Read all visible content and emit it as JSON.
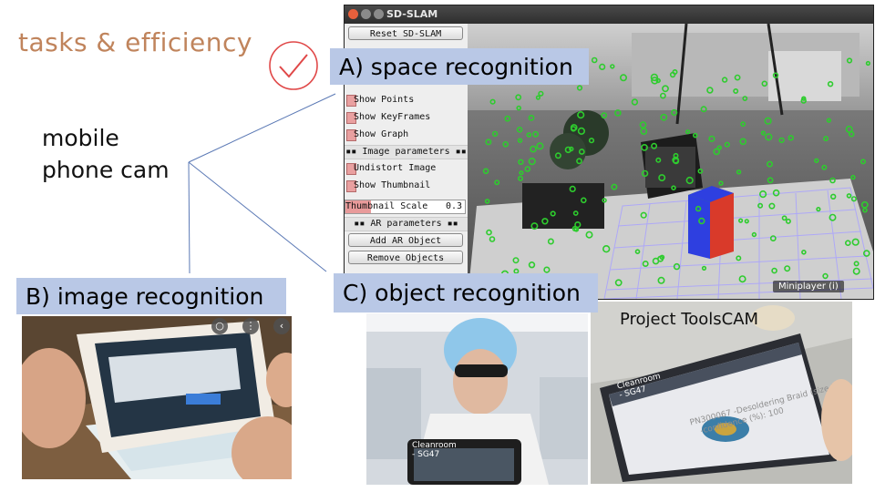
{
  "slide": {
    "title": "tasks & efficiency",
    "camera_label": [
      "mobile",
      "phone cam"
    ],
    "labels": {
      "a": "A) space recognition",
      "b": "B) image recognition",
      "c": "C) object recognition"
    }
  },
  "slam_window": {
    "title": "SD-SLAM",
    "reset_button": "Reset SD-SLAM",
    "show_points": "Show Points",
    "show_keyframes": "Show KeyFrames",
    "show_graph": "Show Graph",
    "image_params_header": "▪▪ Image parameters ▪▪",
    "undistort_image": "Undistort Image",
    "show_thumbnail": "Show Thumbnail",
    "thumbnail_scale_label": "Thumbnail Scale",
    "thumbnail_scale_value": "0.3",
    "ar_params_header": "▪▪ AR parameters ▪▪",
    "add_ar_object": "Add AR Object",
    "remove_objects": "Remove Objects",
    "miniplayer": "Miniplayer (i)"
  },
  "photos": {
    "toolscam_caption": "Project ToolsCAM",
    "tablet_header_1": "Cleanroom - SG47",
    "tablet_header_2": "Cleanroom - SG47"
  },
  "icons": {
    "check": "check-circle-icon",
    "close": "close-icon",
    "minimize": "minimize-icon",
    "maximize": "maximize-icon"
  },
  "colors": {
    "title": "#c0845c",
    "label_bg": "#b9c8e6",
    "check": "#e04848",
    "lines": "#5b79b5",
    "feature_points": "#2ecc2e"
  }
}
